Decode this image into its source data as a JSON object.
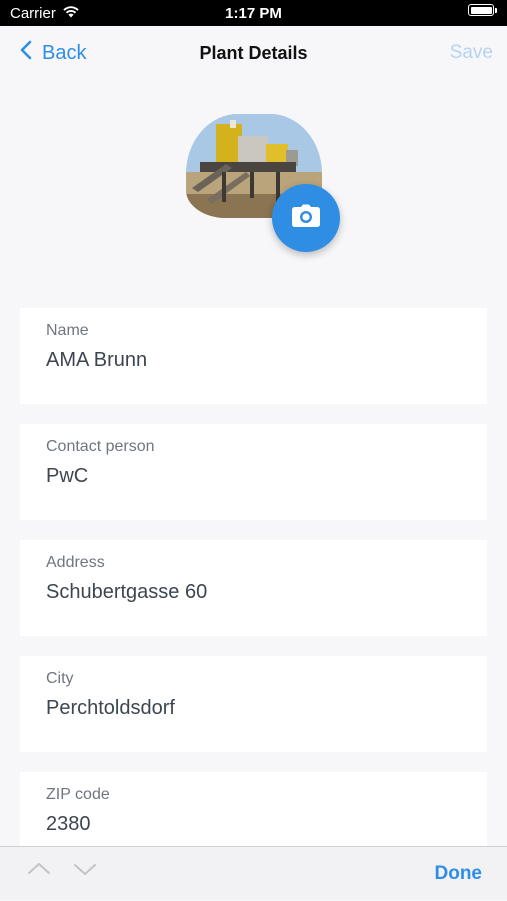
{
  "status_bar": {
    "carrier": "Carrier",
    "time": "1:17 PM",
    "battery_level": 1.0
  },
  "nav": {
    "back_label": "Back",
    "title": "Plant Details",
    "save_label": "Save"
  },
  "colors": {
    "accent": "#2f8ee4",
    "save_disabled": "#b5d4f1",
    "background": "#f7f7f9",
    "label": "#6f7680",
    "value": "#3d4650"
  },
  "photo": {
    "icon": "camera-icon"
  },
  "fields": [
    {
      "label": "Name",
      "value": "AMA Brunn"
    },
    {
      "label": "Contact person",
      "value": "PwC"
    },
    {
      "label": "Address",
      "value": "Schubertgasse 60"
    },
    {
      "label": "City",
      "value": "Perchtoldsdorf"
    },
    {
      "label": "ZIP code",
      "value": "2380"
    }
  ],
  "accessory": {
    "prev_icon": "chevron-up-icon",
    "next_icon": "chevron-down-icon",
    "done_label": "Done"
  }
}
